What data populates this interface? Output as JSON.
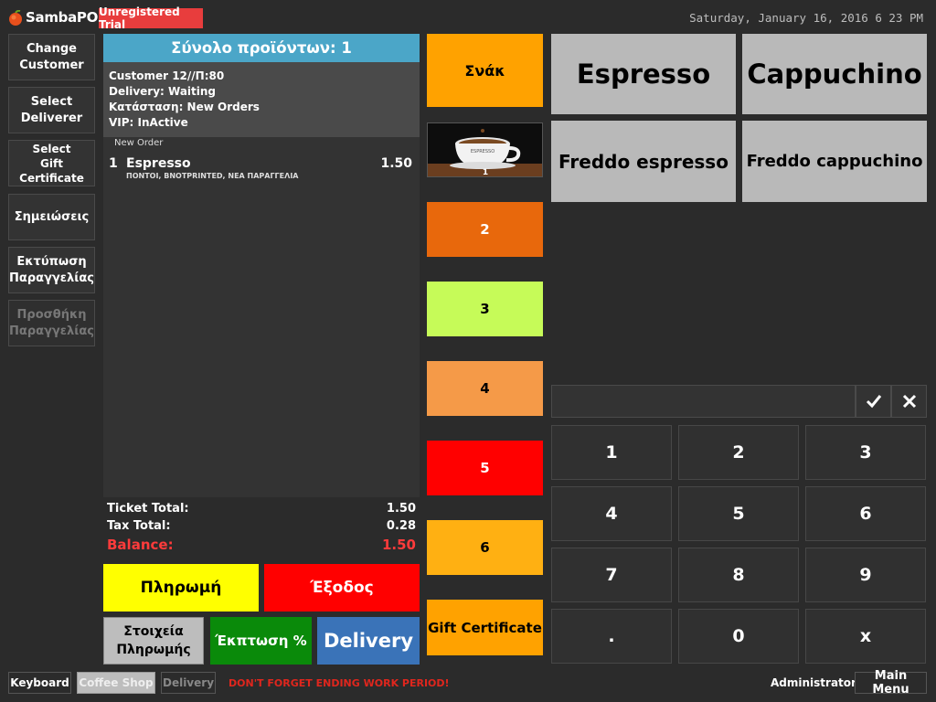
{
  "header": {
    "app_name": "SambaPOS",
    "trial_badge": "Unregistered Trial",
    "datetime": "Saturday, January 16, 2016 6 23 PM"
  },
  "left_buttons": [
    {
      "label": "Change\nCustomer"
    },
    {
      "label": "Select\nDeliverer"
    },
    {
      "label": "Select\nGift Certificate"
    },
    {
      "label": "Σημειώσεις"
    },
    {
      "label": "Εκτύπωση\nΠαραγγελίας"
    },
    {
      "label": "Προσθήκη\nΠαραγγελίας"
    }
  ],
  "ticket": {
    "header": "Σύνολο προϊόντων: 1",
    "info": [
      "Customer 12//Π:80",
      "Delivery: Waiting",
      "Κατάσταση: New Orders",
      "VIP: InActive"
    ],
    "order_label": "New Order",
    "orders": [
      {
        "qty": "1",
        "name": "Espresso",
        "price": "1.50",
        "tags": "ΠΟΝΤΟΙ, BNOTPRINTED, ΝΕΑ ΠΑΡΑΓΓΕΛΙΑ"
      }
    ],
    "totals": {
      "ticket_total_label": "Ticket Total:",
      "ticket_total": "1.50",
      "tax_total_label": "Tax Total:",
      "tax_total": "0.28",
      "balance_label": "Balance:",
      "balance": "1.50"
    }
  },
  "action_buttons": {
    "payment": "Πληρωμή",
    "exit": "Έξοδος",
    "payment_details": "Στοιχεία\nΠληρωμής",
    "discount": "Έκπτωση %",
    "delivery": "Delivery"
  },
  "categories": {
    "snack": "Σνάκ",
    "image_caption": "1",
    "image_cup_text": "ESPRESSO",
    "items": [
      "2",
      "3",
      "4",
      "5",
      "6"
    ],
    "gift_certificate": "Gift Certificate"
  },
  "colors": {
    "snack": "#ffa200",
    "c2": "#e8680c",
    "c3": "#c6fb58",
    "c4": "#f59a48",
    "c5": "#ff0000",
    "c6": "#ffb012",
    "gift": "#ffa200",
    "payment": "#ffff00",
    "exit": "#ff0000",
    "discount": "#0a8a0a",
    "delivery": "#3a73b8",
    "ticket_header": "#4ba6c8",
    "balance": "#ff3b3b"
  },
  "menu_items": [
    "Espresso",
    "Cappuchino",
    "Freddo espresso",
    "Freddo cappuchino"
  ],
  "numpad": {
    "ok_icon": "check-icon",
    "cancel_icon": "close-icon",
    "keys": [
      "1",
      "2",
      "3",
      "4",
      "5",
      "6",
      "7",
      "8",
      "9",
      ".",
      "0",
      "x"
    ]
  },
  "bottom": {
    "keyboard": "Keyboard",
    "coffee_shop": "Coffee Shop",
    "delivery": "Delivery",
    "warning": "DON'T FORGET ENDING WORK PERIOD!",
    "user": "Administrator",
    "main_menu": "Main Menu"
  }
}
